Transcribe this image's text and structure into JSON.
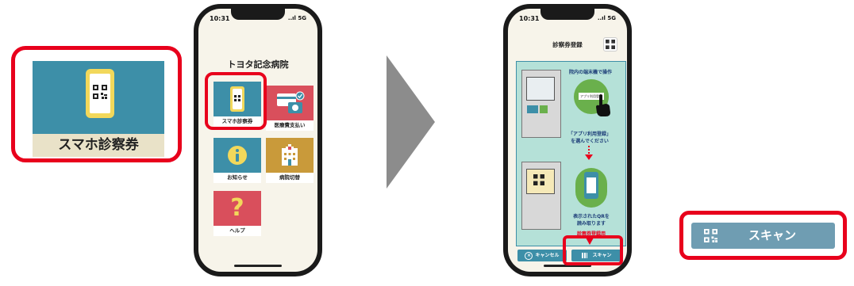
{
  "left_callout": {
    "label": "スマホ診察券",
    "icon": "qr-phone-icon"
  },
  "home_phone": {
    "time": "10:31",
    "signal": "..ıl 5G",
    "hospital_name": "トヨタ記念病院",
    "tiles": [
      {
        "label": "スマホ診察券",
        "icon": "qr-phone-icon",
        "color": "#3d8fa8"
      },
      {
        "label": "医療費支払い",
        "icon": "card-payment-icon",
        "color": "#d94f5c"
      },
      {
        "label": "お知らせ",
        "icon": "info-icon",
        "color": "#3d8fa8"
      },
      {
        "label": "病院切替",
        "icon": "hospital-icon",
        "color": "#c99a3a"
      },
      {
        "label": "ヘルプ",
        "icon": "help-icon",
        "color": "#d94f5c"
      }
    ]
  },
  "scan_phone": {
    "time": "10:31",
    "signal": "..ıl 5G",
    "title": "診察券登録",
    "header_icon": "qr-code-icon",
    "step1_caption": "院内の端末機で操作",
    "step1_button_text": "アプリ利用登録",
    "step1_instruction_line1": "「アプリ利用登録」",
    "step1_instruction_line2": "を選んでください",
    "step2_instruction_line1": "表示されたQRを",
    "step2_instruction_line2": "読み取ります",
    "warning_line1": "診察券登録用",
    "cancel_label": "キャンセル",
    "scan_label": "スキャン"
  },
  "right_callout": {
    "label": "スキャン",
    "icon": "qr-code-icon"
  },
  "colors": {
    "accent_red": "#e8001c",
    "teal": "#3d8fa8",
    "arrow_gray": "#8c8c8c"
  }
}
